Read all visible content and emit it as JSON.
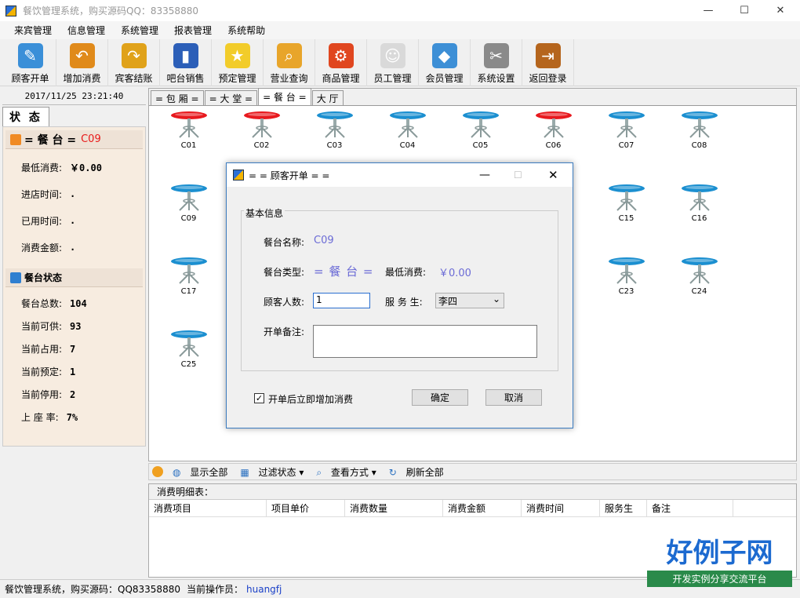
{
  "window": {
    "title": "餐饮管理系统，购买源码QQ：83358880",
    "minimize": "—",
    "maximize": "☐",
    "close": "✕"
  },
  "menu": [
    "来宾管理",
    "信息管理",
    "系统管理",
    "报表管理",
    "系统帮助"
  ],
  "toolbar": [
    {
      "label": "顾客开单",
      "icon": "open-order-icon",
      "color": "#3a8fd8",
      "glyph": "✎"
    },
    {
      "label": "增加消费",
      "icon": "add-consume-icon",
      "color": "#e08a1a",
      "glyph": "↶"
    },
    {
      "label": "宾客结账",
      "icon": "checkout-icon",
      "color": "#e0a21a",
      "glyph": "↷"
    },
    {
      "label": "吧台销售",
      "icon": "bar-sales-icon",
      "color": "#2c5fb8",
      "glyph": "▮"
    },
    {
      "label": "预定管理",
      "icon": "reserve-icon",
      "color": "#f2cc2a",
      "glyph": "★"
    },
    {
      "label": "营业查询",
      "icon": "query-icon",
      "color": "#e8a52a",
      "glyph": "⌕"
    },
    {
      "label": "商品管理",
      "icon": "goods-icon",
      "color": "#e0461f",
      "glyph": "⚙"
    },
    {
      "label": "员工管理",
      "icon": "staff-icon",
      "color": "#d9d9d9",
      "glyph": "☺"
    },
    {
      "label": "会员管理",
      "icon": "member-icon",
      "color": "#3d8fd6",
      "glyph": "◆"
    },
    {
      "label": "系统设置",
      "icon": "settings-icon",
      "color": "#8a8a8a",
      "glyph": "✂"
    },
    {
      "label": "返回登录",
      "icon": "exit-icon",
      "color": "#b5651d",
      "glyph": "⇥"
    }
  ],
  "left": {
    "datetime": "2017/11/25 23:21:40",
    "status_tab": "状 态",
    "seat_header": {
      "prefix": "= 餐 台 =",
      "code": "C09"
    },
    "seat_info": [
      {
        "label": "最低消费:",
        "value": "￥0.00"
      },
      {
        "label": "进店时间:",
        "value": "."
      },
      {
        "label": "已用时间:",
        "value": "."
      },
      {
        "label": "消费金额:",
        "value": "."
      }
    ],
    "stat_header": "餐台状态",
    "stats": [
      {
        "label": "餐台总数:",
        "value": "104"
      },
      {
        "label": "当前可供:",
        "value": "93"
      },
      {
        "label": "当前占用:",
        "value": "7"
      },
      {
        "label": "当前预定:",
        "value": "1"
      },
      {
        "label": "当前停用:",
        "value": "2"
      },
      {
        "label": "上 座 率:",
        "value": "7%"
      }
    ]
  },
  "tabs": [
    "= 包 厢 =",
    "= 大 堂 =",
    "= 餐 台 =",
    "大 厅"
  ],
  "seats": [
    {
      "name": "C01",
      "state": "occupied"
    },
    {
      "name": "C02",
      "state": "occupied"
    },
    {
      "name": "C03",
      "state": "free"
    },
    {
      "name": "C04",
      "state": "free"
    },
    {
      "name": "C05",
      "state": "free"
    },
    {
      "name": "C06",
      "state": "occupied"
    },
    {
      "name": "C07",
      "state": "free"
    },
    {
      "name": "C08",
      "state": "free"
    },
    {
      "name": "C09",
      "state": "free"
    },
    {
      "name": "C15",
      "state": "free"
    },
    {
      "name": "C16",
      "state": "free"
    },
    {
      "name": "C17",
      "state": "free"
    },
    {
      "name": "C23",
      "state": "free"
    },
    {
      "name": "C24",
      "state": "free"
    },
    {
      "name": "C25",
      "state": "free"
    }
  ],
  "colors": {
    "occupied": "#e8191e",
    "free": "#1b8fd0"
  },
  "bottom_tools": [
    "显示全部",
    "过滤状态 ▾",
    "查看方式 ▾",
    "刷新全部"
  ],
  "detail": {
    "title": "消费明细表：",
    "columns": [
      "消费项目",
      "项目单价",
      "消费数量",
      "消费金额",
      "消费时间",
      "服务生",
      "备注"
    ]
  },
  "statusbar": {
    "text": "餐饮管理系统，购买源码：QQ83358880",
    "operator_label": "当前操作员：",
    "operator": "huangfj"
  },
  "dialog": {
    "title": "= = 顾客开单 = =",
    "group": "基本信息",
    "seat_name_label": "餐台名称:",
    "seat_name": "C09",
    "seat_type_label": "餐台类型:",
    "seat_type": "= 餐 台 =",
    "min_label": "最低消费:",
    "min_value": "￥0.00",
    "guests_label": "顾客人数:",
    "guests": "1",
    "waiter_label": "服 务 生:",
    "waiter": "李四",
    "note_label": "开单备注:",
    "checkbox_label": "开单后立即增加消费",
    "ok": "确定",
    "cancel": "取消"
  },
  "watermark": {
    "main": "好例子网",
    "sub": "开发实例分享交流平台"
  }
}
